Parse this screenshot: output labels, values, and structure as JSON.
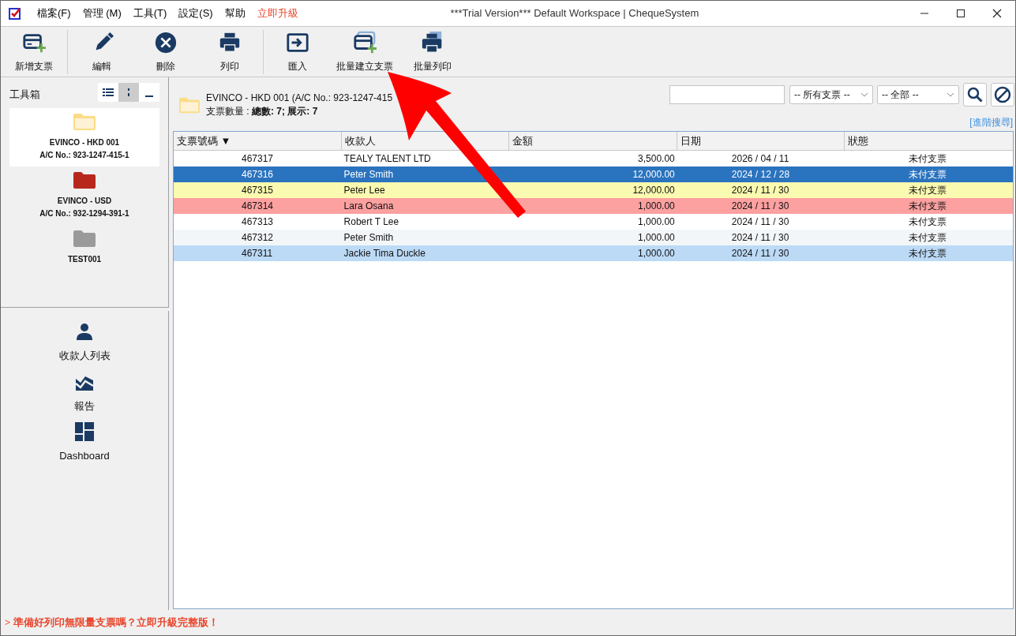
{
  "window": {
    "title": "***Trial Version*** Default Workspace | ChequeSystem"
  },
  "menu": [
    {
      "label": "檔案(F)",
      "kind": "menu"
    },
    {
      "label": "管理 (M)",
      "kind": "menu"
    },
    {
      "label": "工具(T)",
      "kind": "menu"
    },
    {
      "label": "設定(S)",
      "kind": "menu"
    },
    {
      "label": "幫助",
      "kind": "menu"
    },
    {
      "label": "立即升級",
      "kind": "promo"
    }
  ],
  "toolbar": [
    [
      {
        "label": "新增支票",
        "kind": "new"
      }
    ],
    [
      {
        "label": "編輯",
        "kind": "edit"
      },
      {
        "label": "刪除",
        "kind": "delete"
      },
      {
        "label": "列印",
        "kind": "print"
      }
    ],
    [
      {
        "label": "匯入",
        "kind": "import"
      },
      {
        "label": "批量建立支票",
        "kind": "batch-new"
      },
      {
        "label": "批量列印",
        "kind": "batch-print"
      }
    ]
  ],
  "toolbox": {
    "title": "工具箱",
    "view_list_selected": false,
    "view_compact_selected": true,
    "accounts": [
      {
        "name": "EVINCO - HKD 001",
        "account": "A/C No.: 923-1247-415-1",
        "color": "#fbdc86",
        "selected": true
      },
      {
        "name": "EVINCO - USD",
        "account": "A/C No.: 932-1294-391-1",
        "color": "#b8271c",
        "selected": false
      },
      {
        "name": "TEST001",
        "color": "#9a9a9a",
        "selected": false
      }
    ]
  },
  "nav": [
    {
      "label": "收款人列表",
      "kind": "payees"
    },
    {
      "label": "報告",
      "kind": "reports"
    },
    {
      "label": "Dashboard",
      "kind": "dashboard"
    }
  ],
  "header": {
    "account": "EVINCO - HKD 001 (A/C No.: 923-1247-415",
    "count_label": "支票數量 : ",
    "count": "總數: 7; 展示: 7"
  },
  "search": {
    "filter": "-- 所有支票 --",
    "scope": "-- 全部  --",
    "advanced": "[進階搜尋]"
  },
  "table": {
    "columns": [
      {
        "label": "支票號碼 ▼"
      },
      {
        "label": "收款人"
      },
      {
        "label": "金額"
      },
      {
        "label": "日期"
      },
      {
        "label": "狀態"
      }
    ],
    "rows": [
      {
        "cells": [
          "467317",
          "TEALY TALENT LTD",
          "3,500.00",
          "2026 / 04 / 11",
          "未付支票"
        ],
        "color": "#ffffff",
        "selected": false
      },
      {
        "cells": [
          "467316",
          "Peter Smith",
          "12,000.00",
          "2024 / 12 / 28",
          "未付支票"
        ],
        "color": "#2a73be",
        "selected": true
      },
      {
        "cells": [
          "467315",
          "Peter Lee",
          "12,000.00",
          "2024 / 11 / 30",
          "未付支票"
        ],
        "color": "#fafab0",
        "selected": false
      },
      {
        "cells": [
          "467314",
          "Lara Osana",
          "1,000.00",
          "2024 / 11 / 30",
          "未付支票"
        ],
        "color": "#fca0a0",
        "selected": false
      },
      {
        "cells": [
          "467313",
          "Robert T Lee",
          "1,000.00",
          "2024 / 11 / 30",
          "未付支票"
        ],
        "color": "#ffffff",
        "selected": false
      },
      {
        "cells": [
          "467312",
          "Peter Smith",
          "1,000.00",
          "2024 / 11 / 30",
          "未付支票"
        ],
        "color": "#f3f6f9",
        "selected": false
      },
      {
        "cells": [
          "467311",
          "Jackie Tima Duckle",
          "1,000.00",
          "2024 / 11 / 30",
          "未付支票"
        ],
        "color": "#bcdaf6",
        "selected": false
      }
    ]
  },
  "footer": {
    "message": "> 準備好列印無限量支票嗎？立即升級完整版！"
  }
}
